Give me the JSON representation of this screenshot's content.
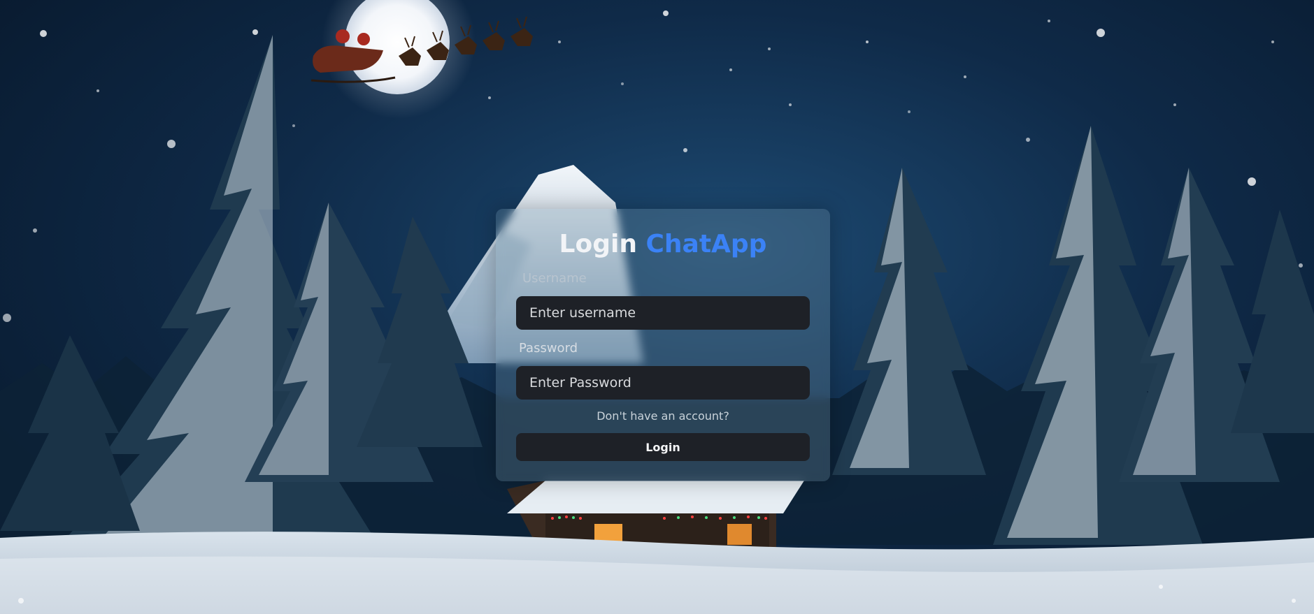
{
  "login": {
    "title_prefix": "Login",
    "title_brand": "ChatApp",
    "username_label": "Username",
    "username_placeholder": "Enter username",
    "password_label": "Password",
    "password_placeholder": "Enter Password",
    "signup_link": "Don't have an account?",
    "submit_label": "Login"
  },
  "colors": {
    "brand": "#3b82f6",
    "input_bg": "#1e2127",
    "sky": "#0f2a48"
  }
}
